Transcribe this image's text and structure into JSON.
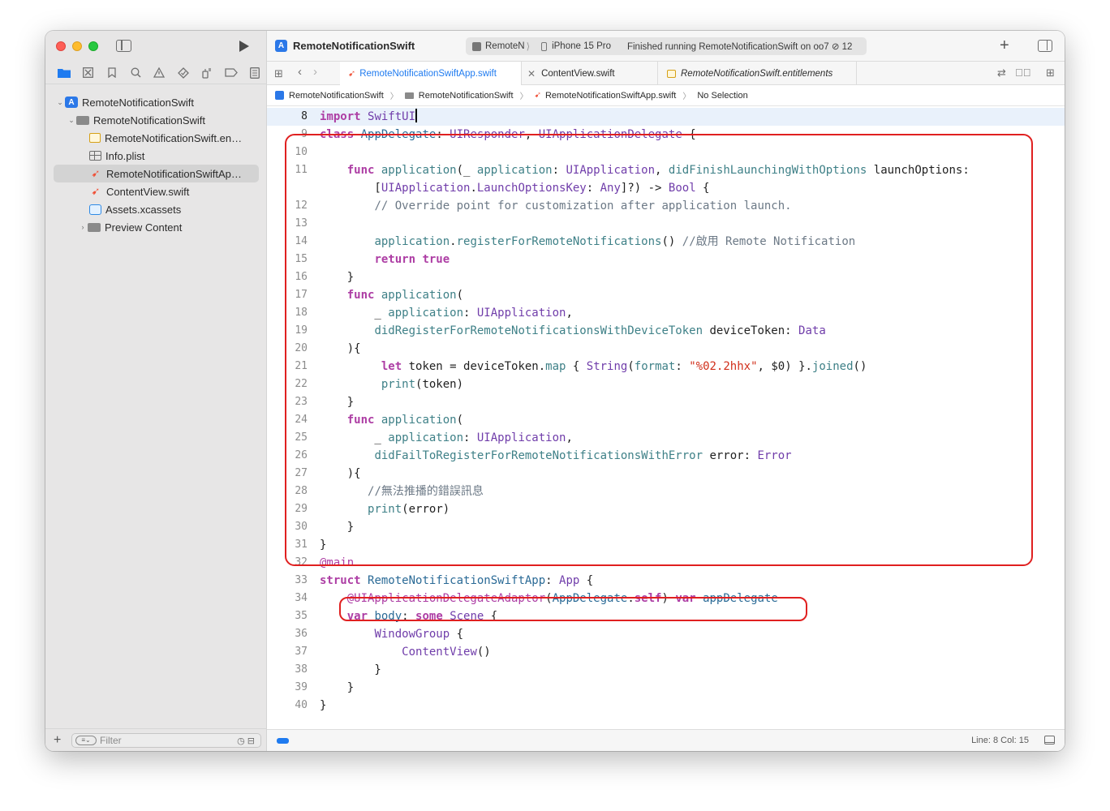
{
  "sidebar": {
    "nav_tabs": [
      "folder-icon",
      "source-control-icon",
      "bookmark-icon",
      "find-icon",
      "issue-icon",
      "test-icon",
      "debug-icon",
      "breakpoint-icon",
      "report-icon"
    ],
    "tree": [
      {
        "label": "RemoteNotificationSwift",
        "icon": "project-icon",
        "disclosure": "⌄"
      },
      {
        "label": "RemoteNotificationSwift",
        "icon": "folder-icon",
        "disclosure": "⌄"
      },
      {
        "label": "RemoteNotificationSwift.en…",
        "icon": "entitlements-icon",
        "disclosure": ""
      },
      {
        "label": "Info.plist",
        "icon": "plist-icon",
        "disclosure": ""
      },
      {
        "label": "RemoteNotificationSwiftAp…",
        "icon": "swift-file-icon",
        "disclosure": "",
        "selected": true
      },
      {
        "label": "ContentView.swift",
        "icon": "swift-file-icon",
        "disclosure": ""
      },
      {
        "label": "Assets.xcassets",
        "icon": "assets-icon",
        "disclosure": ""
      },
      {
        "label": "Preview Content",
        "icon": "folder-icon",
        "disclosure": "›"
      }
    ],
    "filter_placeholder": "Filter"
  },
  "toolbar": {
    "project_title": "RemoteNotificationSwift",
    "scheme": "RemoteN",
    "device": "iPhone 15 Pro",
    "status": "Finished running RemoteNotificationSwift on oo7 ⊘ 12"
  },
  "tabs": [
    {
      "label": "RemoteNotificationSwiftApp.swift",
      "active": true
    },
    {
      "label": "ContentView.swift",
      "active": false
    },
    {
      "label": "RemoteNotificationSwift.entitlements",
      "active": false
    }
  ],
  "jumpbar": {
    "project": "RemoteNotificationSwift",
    "group": "RemoteNotificationSwift",
    "file": "RemoteNotificationSwiftApp.swift",
    "selection": "No Selection"
  },
  "code": {
    "current_line": 8,
    "lines": [
      {
        "num": "8",
        "text": "import SwiftUI"
      },
      {
        "num": "9",
        "text": "class AppDelegate: UIResponder, UIApplicationDelegate {"
      },
      {
        "num": "10",
        "text": ""
      },
      {
        "num": "11",
        "text": "    func application(_ application: UIApplication, didFinishLaunchingWithOptions launchOptions:"
      },
      {
        "num": "",
        "text": "        [UIApplication.LaunchOptionsKey: Any]?) -> Bool {"
      },
      {
        "num": "12",
        "text": "        // Override point for customization after application launch."
      },
      {
        "num": "13",
        "text": ""
      },
      {
        "num": "14",
        "text": "        application.registerForRemoteNotifications() //啟用 Remote Notification"
      },
      {
        "num": "15",
        "text": "        return true"
      },
      {
        "num": "16",
        "text": "    }"
      },
      {
        "num": "17",
        "text": "    func application("
      },
      {
        "num": "18",
        "text": "        _ application: UIApplication,"
      },
      {
        "num": "19",
        "text": "        didRegisterForRemoteNotificationsWithDeviceToken deviceToken: Data"
      },
      {
        "num": "20",
        "text": "    ){"
      },
      {
        "num": "21",
        "text": "         let token = deviceToken.map { String(format: \"%02.2hhx\", $0) }.joined()"
      },
      {
        "num": "22",
        "text": "         print(token)"
      },
      {
        "num": "23",
        "text": "    }"
      },
      {
        "num": "24",
        "text": "    func application("
      },
      {
        "num": "25",
        "text": "        _ application: UIApplication,"
      },
      {
        "num": "26",
        "text": "        didFailToRegisterForRemoteNotificationsWithError error: Error"
      },
      {
        "num": "27",
        "text": "    ){"
      },
      {
        "num": "28",
        "text": "       //無法推播的錯誤訊息"
      },
      {
        "num": "29",
        "text": "       print(error)"
      },
      {
        "num": "30",
        "text": "    }"
      },
      {
        "num": "31",
        "text": "}"
      },
      {
        "num": "32",
        "text": "@main"
      },
      {
        "num": "33",
        "text": "struct RemoteNotificationSwiftApp: App {"
      },
      {
        "num": "34",
        "text": "    @UIApplicationDelegateAdaptor(AppDelegate.self) var appDelegate"
      },
      {
        "num": "35",
        "text": "    var body: some Scene {"
      },
      {
        "num": "36",
        "text": "        WindowGroup {"
      },
      {
        "num": "37",
        "text": "            ContentView()"
      },
      {
        "num": "38",
        "text": "        }"
      },
      {
        "num": "39",
        "text": "    }"
      },
      {
        "num": "40",
        "text": "}"
      }
    ]
  },
  "status_bar": {
    "line_col": "Line: 8  Col: 15"
  },
  "colors": {
    "keyword": "#ad3da4",
    "type": "#703daa",
    "function": "#3e8087",
    "comment": "#6c7986",
    "string": "#d12f1b",
    "accent": "#1f7bf0",
    "annotation": "#e02020"
  }
}
